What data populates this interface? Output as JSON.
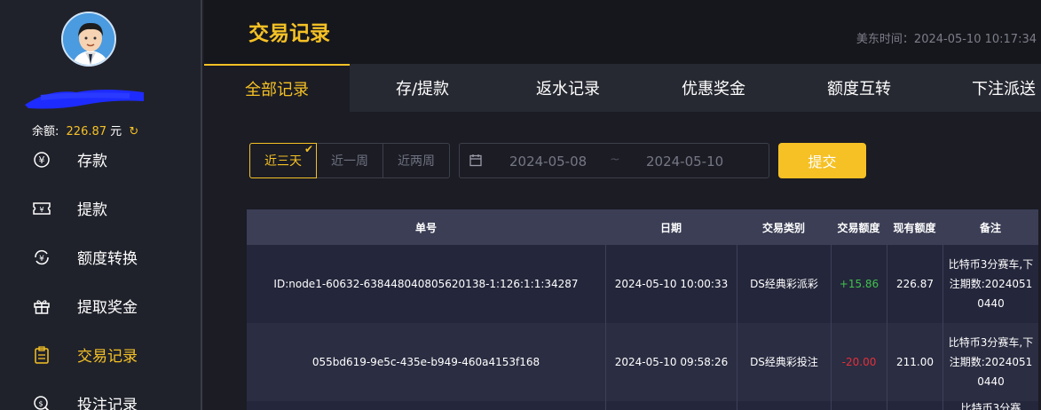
{
  "sidebar": {
    "balance_label": "余额:",
    "balance_amount": "226.87",
    "balance_unit": "元",
    "items": [
      {
        "label": "存款",
        "icon": "yen-coin-icon"
      },
      {
        "label": "提款",
        "icon": "ticket-icon"
      },
      {
        "label": "额度转换",
        "icon": "exchange-coin-icon"
      },
      {
        "label": "提取奖金",
        "icon": "gift-icon"
      },
      {
        "label": "交易记录",
        "icon": "clipboard-icon",
        "active": true
      },
      {
        "label": "投注记录",
        "icon": "search-record-icon"
      }
    ]
  },
  "header": {
    "title": "交易记录",
    "time": "美东时间：2024-05-10 10:17:34"
  },
  "tabs": [
    "全部记录",
    "存/提款",
    "返水记录",
    "优惠奖金",
    "额度互转",
    "下注派送"
  ],
  "filters": {
    "ranges": [
      "近三天",
      "近一周",
      "近两周"
    ],
    "active_range": "近三天",
    "date_from": "2024-05-08",
    "date_sep": "~",
    "date_to": "2024-05-10",
    "submit_label": "提交"
  },
  "table": {
    "headers": [
      "单号",
      "日期",
      "交易类别",
      "交易额度",
      "现有额度",
      "备注"
    ],
    "rows": [
      {
        "id": "ID:node1-60632-638448040805620138-1:126:1:1:34287",
        "date": "2024-05-10 10:00:33",
        "type": "DS经典彩派彩",
        "amount": "+15.86",
        "balance": "226.87",
        "note": "比特币3分赛车,下注期数:20240510440"
      },
      {
        "id": "055bd619-9e5c-435e-b949-460a4153f168",
        "date": "2024-05-10 09:58:26",
        "type": "DS经典彩投注",
        "amount": "-20.00",
        "balance": "211.00",
        "note": "比特币3分赛车,下注期数:20240510440"
      }
    ],
    "partial_row_note": "比特币3分赛"
  },
  "colors": {
    "accent": "#f5c125",
    "positive": "#3fc24d",
    "negative": "#e3303a"
  }
}
